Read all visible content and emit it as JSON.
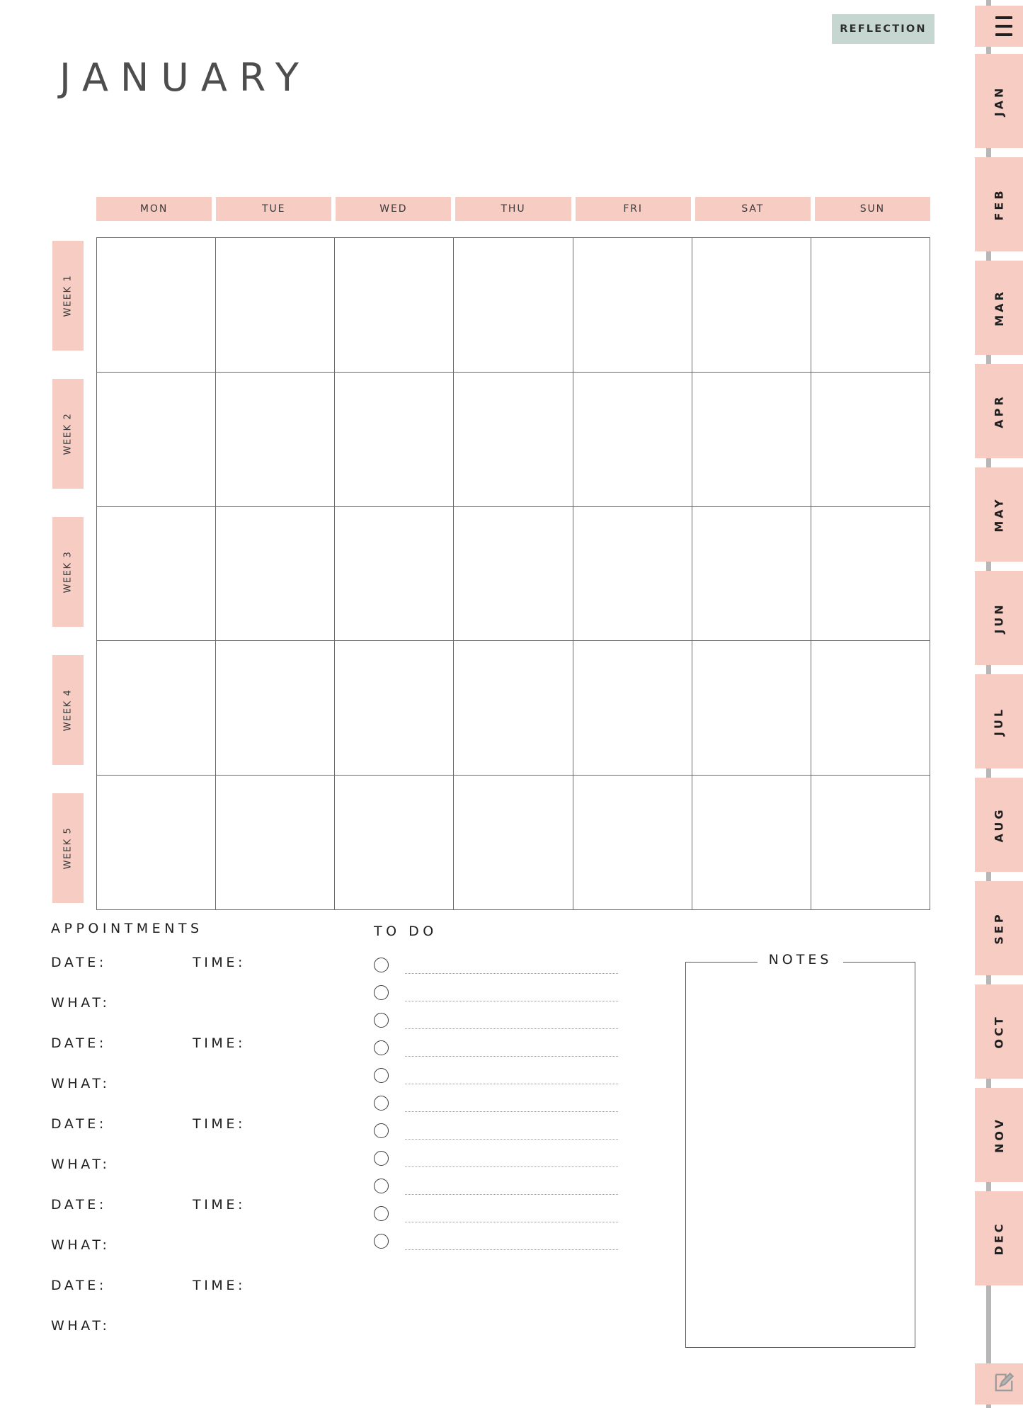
{
  "header": {
    "reflection_label": "REFLECTION",
    "month_title": "JANUARY"
  },
  "calendar": {
    "day_headers": [
      "MON",
      "TUE",
      "WED",
      "THU",
      "FRI",
      "SAT",
      "SUN"
    ],
    "week_labels": [
      "WEEK 1",
      "WEEK 2",
      "WEEK 3",
      "WEEK 4",
      "WEEK 5"
    ],
    "rows": 5,
    "cols": 7,
    "cells": [
      [
        "",
        "",
        "",
        "",
        "",
        "",
        ""
      ],
      [
        "",
        "",
        "",
        "",
        "",
        "",
        ""
      ],
      [
        "",
        "",
        "",
        "",
        "",
        "",
        ""
      ],
      [
        "",
        "",
        "",
        "",
        "",
        "",
        ""
      ],
      [
        "",
        "",
        "",
        "",
        "",
        "",
        ""
      ]
    ]
  },
  "appointments": {
    "title": "APPOINTMENTS",
    "date_label": "DATE:",
    "time_label": "TIME:",
    "what_label": "WHAT:",
    "entries": [
      {
        "date": "",
        "time": "",
        "what": ""
      },
      {
        "date": "",
        "time": "",
        "what": ""
      },
      {
        "date": "",
        "time": "",
        "what": ""
      },
      {
        "date": "",
        "time": "",
        "what": ""
      },
      {
        "date": "",
        "time": "",
        "what": ""
      }
    ]
  },
  "todo": {
    "title": "TO DO",
    "items": [
      "",
      "",
      "",
      "",
      "",
      "",
      "",
      "",
      "",
      "",
      ""
    ]
  },
  "notes": {
    "title": "NOTES",
    "content": ""
  },
  "sidebar": {
    "menu_icon": "hamburger-menu-icon",
    "edit_icon": "pencil-edit-icon",
    "months": [
      "JAN",
      "FEB",
      "MAR",
      "APR",
      "MAY",
      "JUN",
      "JUL",
      "AUG",
      "SEP",
      "OCT",
      "NOV",
      "DEC"
    ],
    "active_month": "JAN"
  },
  "colors": {
    "pink": "#f7cdc3",
    "sage": "#c6d7d1",
    "ink": "#1f1f1f",
    "grid_line": "#6a6a6a",
    "rail": "#b7b7b7"
  }
}
